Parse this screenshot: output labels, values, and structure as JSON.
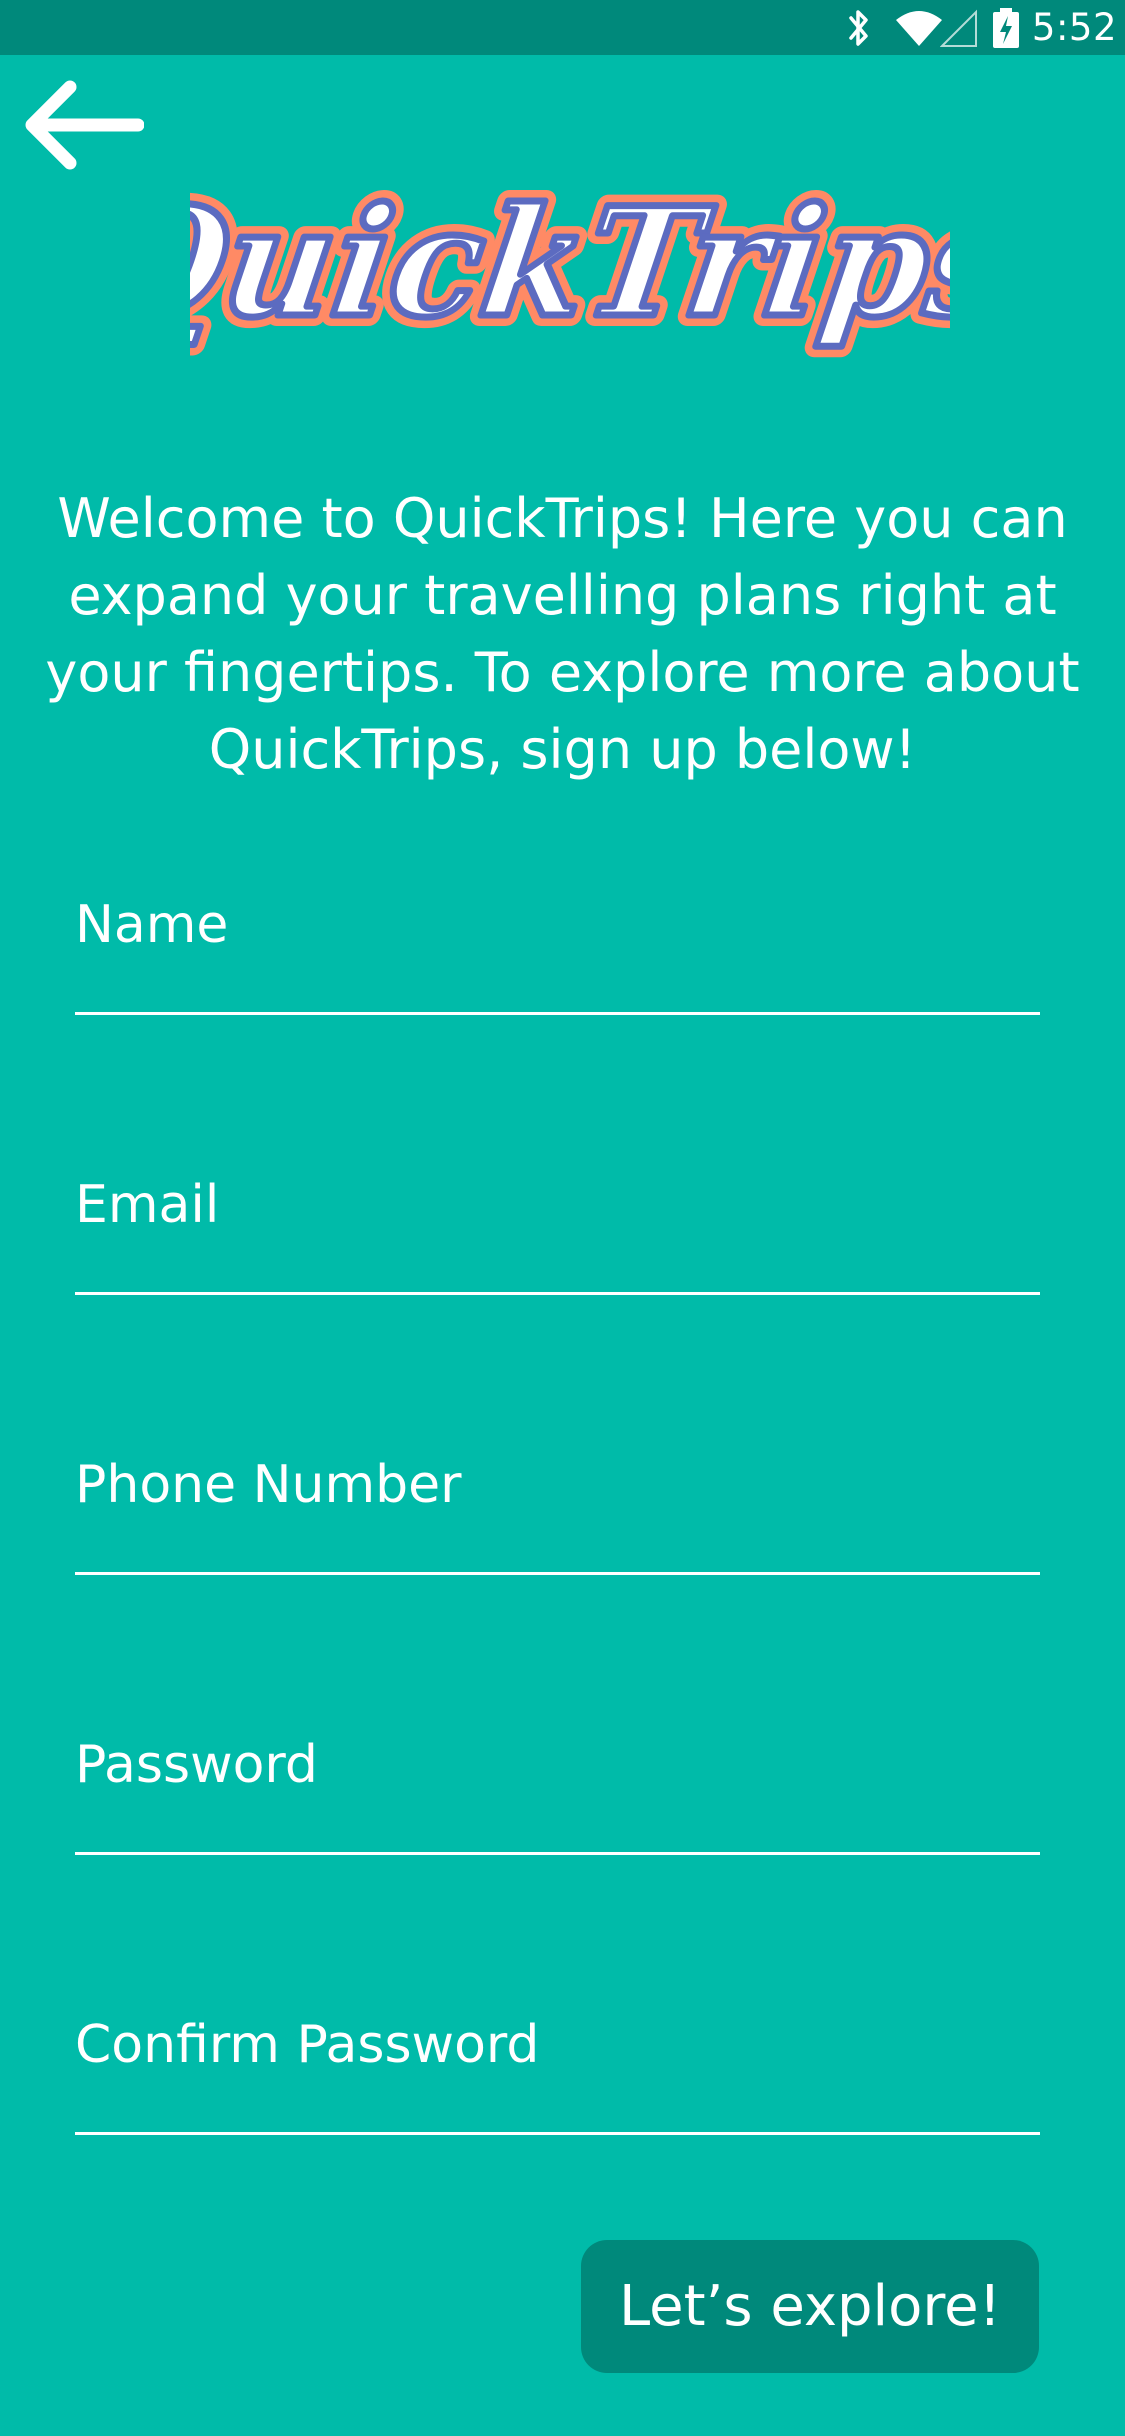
{
  "status_bar": {
    "time": "5:52",
    "icons": [
      "bluetooth-icon",
      "wifi-icon",
      "cell-signal-icon",
      "battery-charging-icon"
    ],
    "color": "#00897B"
  },
  "header": {
    "back_icon": "arrow-left-icon",
    "logo_text": "QuickTrips"
  },
  "welcome": {
    "text": "Welcome to QuickTrips! Here you can expand your travelling plans right at your fingertips. To explore more about QuickTrips, sign up below!"
  },
  "form": {
    "fields": [
      {
        "label": "Name",
        "value": ""
      },
      {
        "label": "Email",
        "value": ""
      },
      {
        "label": "Phone Number",
        "value": ""
      },
      {
        "label": "Password",
        "value": ""
      },
      {
        "label": "Confirm Password",
        "value": ""
      }
    ],
    "submit_label": "Let’s explore!"
  },
  "colors": {
    "background": "#00BBA9",
    "accent": "#00897B",
    "text": "#FFFFFF",
    "logo_fill": "#FFFFFF",
    "logo_inner_stroke": "#5C6BC0",
    "logo_outer_stroke": "#FF8A65"
  }
}
